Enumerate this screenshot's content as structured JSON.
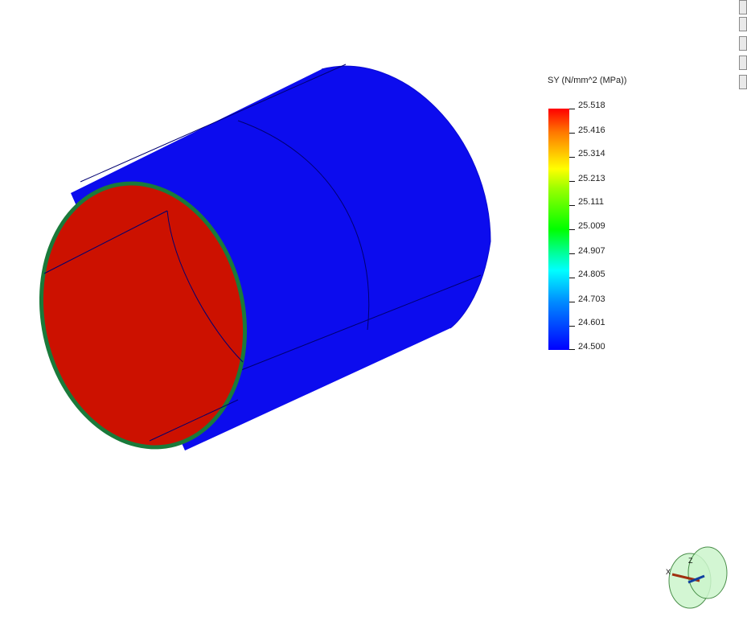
{
  "legend": {
    "title": "SY (N/mm^2 (MPa))",
    "ticks": [
      "25.518",
      "25.416",
      "25.314",
      "25.213",
      "25.111",
      "25.009",
      "24.907",
      "24.805",
      "24.703",
      "24.601",
      "24.500"
    ]
  },
  "triad": {
    "x_label": "X",
    "z_label": "Z"
  },
  "colors": {
    "inner_surface": "#cc1100",
    "outer_surface": "#0c0cee",
    "rim": "#1a7a3a",
    "mesh_line": "#000060"
  }
}
